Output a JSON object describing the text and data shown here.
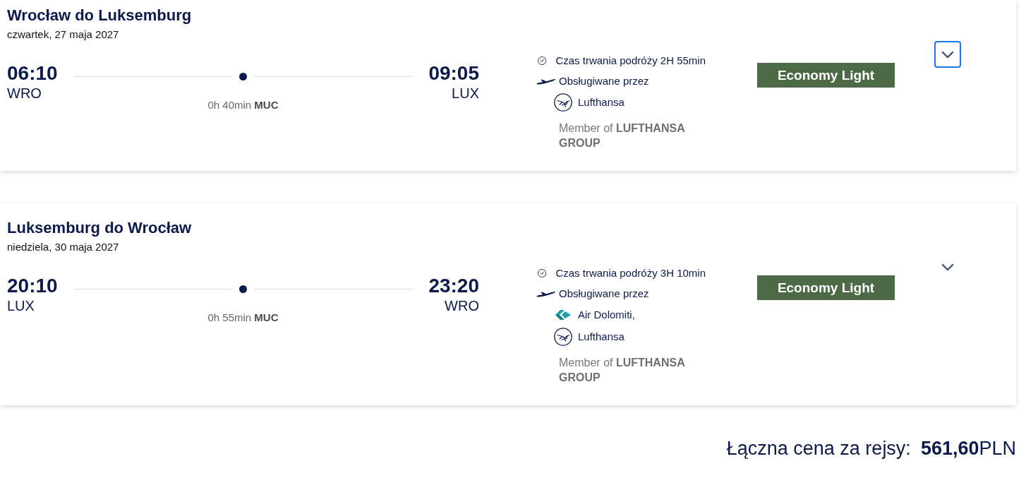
{
  "flights": [
    {
      "title": "Wrocław do Luksemburg",
      "date": "czwartek, 27 maja 2027",
      "departure": {
        "time": "06:10",
        "airport": "WRO"
      },
      "arrival": {
        "time": "09:05",
        "airport": "LUX"
      },
      "stop": "0h 40min **MUC**",
      "duration": "Czas trwania podróży 2H 55min",
      "operated_by": "Obsługiwane przez",
      "operators": [
        {
          "kind": "lufthansa",
          "name": "Lufthansa"
        }
      ],
      "alliance": "Member of **LUFTHANSA GROUP**",
      "fare": "Economy Light",
      "expand": {
        "focused": true
      }
    },
    {
      "title": "Luksemburg do Wrocław",
      "date": "niedziela, 30 maja 2027",
      "departure": {
        "time": "20:10",
        "airport": "LUX"
      },
      "arrival": {
        "time": "23:20",
        "airport": "WRO"
      },
      "stop": "0h 55min **MUC**",
      "duration": "Czas trwania podróży 3H 10min",
      "operated_by": "Obsługiwane przez",
      "operators": [
        {
          "kind": "air-dolomiti",
          "name": "Air Dolomiti,"
        },
        {
          "kind": "lufthansa",
          "name": "Lufthansa"
        }
      ],
      "alliance": "Member of **LUFTHANSA GROUP**",
      "fare": "Economy Light",
      "expand": {
        "focused": false
      }
    }
  ],
  "total": {
    "label": "Łączna cena za rejsy:",
    "amount": "561,60",
    "currency": "PLN"
  }
}
